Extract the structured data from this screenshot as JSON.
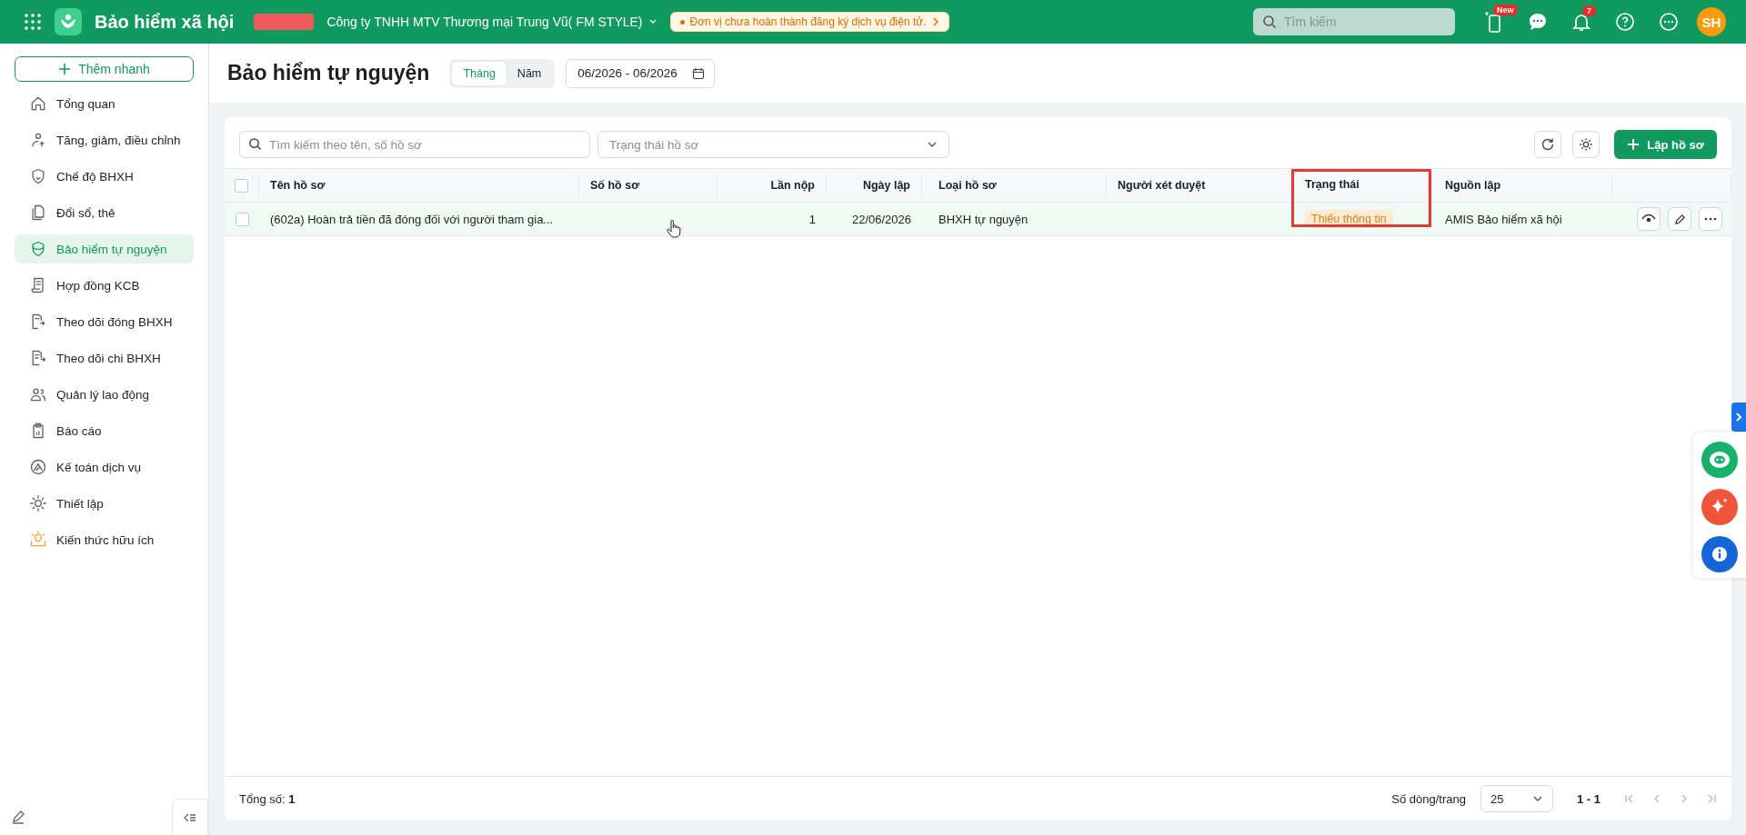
{
  "header": {
    "app_title": "Bảo hiểm xã hội",
    "company": "Công ty TNHH MTV Thương mại Trung Vũ( FM STYLE)",
    "notice": "Đơn vị chưa hoàn thành đăng ký dịch vụ điện tử.",
    "search": {
      "placeholder": "Tìm kiếm"
    },
    "new_badge": "New",
    "notification_count": "7",
    "avatar": "SH"
  },
  "sidebar": {
    "add_button": "Thêm nhanh",
    "items": [
      {
        "label": "Tổng quan",
        "selected": false
      },
      {
        "label": "Tăng, giảm, điều chỉnh",
        "selected": false
      },
      {
        "label": "Chế độ BHXH",
        "selected": false
      },
      {
        "label": "Đổi sổ, thẻ",
        "selected": false
      },
      {
        "label": "Bảo hiểm tự nguyện",
        "selected": true
      },
      {
        "label": "Hợp đồng KCB",
        "selected": false
      },
      {
        "label": "Theo dõi đóng BHXH",
        "selected": false
      },
      {
        "label": "Theo dõi chi BHXH",
        "selected": false
      },
      {
        "label": "Quản lý lao động",
        "selected": false
      },
      {
        "label": "Báo cáo",
        "selected": false
      },
      {
        "label": "Kế toán dịch vụ",
        "selected": false
      },
      {
        "label": "Thiết lập",
        "selected": false
      },
      {
        "label": "Kiến thức hữu ích",
        "selected": false
      }
    ]
  },
  "page": {
    "title": "Bảo hiểm tự nguyện",
    "period_tabs": [
      {
        "label": "Tháng",
        "selected": true
      },
      {
        "label": "Năm",
        "selected": false
      }
    ],
    "date_range": "06/2026 - 06/2026"
  },
  "toolbar": {
    "search": {
      "placeholder": "Tìm kiếm theo tên, số hồ sơ"
    },
    "status_filter": {
      "placeholder": "Trạng thái hồ sơ"
    },
    "create_button": "Lập hồ sơ"
  },
  "table": {
    "all_checked": false,
    "columns": [
      {
        "label": "Tên hồ sơ",
        "highlighted": false
      },
      {
        "label": "Số hồ sơ",
        "highlighted": false
      },
      {
        "label": "Lần nộp",
        "highlighted": false
      },
      {
        "label": "Ngày lập",
        "highlighted": false
      },
      {
        "label": "Loại hồ sơ",
        "highlighted": false
      },
      {
        "label": "Người xét duyệt",
        "highlighted": false
      },
      {
        "label": "Trạng thái",
        "highlighted": true
      },
      {
        "label": "Nguồn lập",
        "highlighted": false
      }
    ],
    "rows": [
      {
        "checked": false,
        "hovered": true,
        "name": "(602a) Hoàn trả tiền đã đóng đối với người tham gia...",
        "submissions": "1",
        "date": "22/06/2026",
        "type": "BHXH tự nguyện",
        "status": "Thiếu thông tin",
        "source": "AMIS Bảo hiểm xã hội"
      }
    ]
  },
  "footer": {
    "total_label": "Tổng số:",
    "total": "1",
    "page_size_label": "Số dòng/trang",
    "page_size": "25",
    "range": "1 - 1"
  }
}
